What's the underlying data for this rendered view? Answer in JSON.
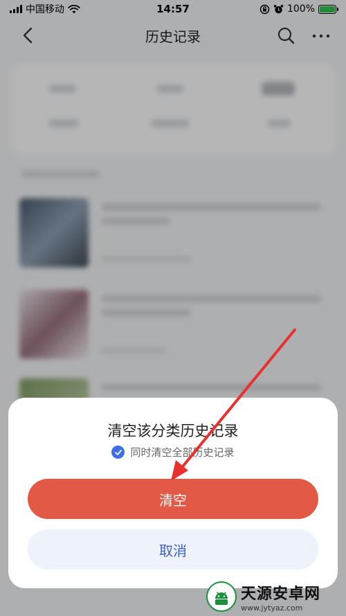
{
  "status_bar": {
    "carrier": "中国移动",
    "time": "14:57",
    "battery_percent": "100%",
    "battery_level": 1.0
  },
  "nav": {
    "title": "历史记录",
    "back_icon": "chevron-left-icon",
    "search_icon": "search-icon",
    "more_icon": "more-dots-icon"
  },
  "dialog": {
    "title": "清空该分类历史记录",
    "option_label": "同时清空全部历史记录",
    "option_checked": true,
    "confirm_label": "清空",
    "cancel_label": "取消"
  },
  "colors": {
    "confirm": "#e25a46",
    "cancel_bg": "#eef3fb",
    "cancel_text": "#3a62c4",
    "check": "#3d6ee8",
    "arrow": "#e8312f"
  },
  "watermark": {
    "name": "天源安卓网",
    "url": "www.jytyaz.com"
  }
}
